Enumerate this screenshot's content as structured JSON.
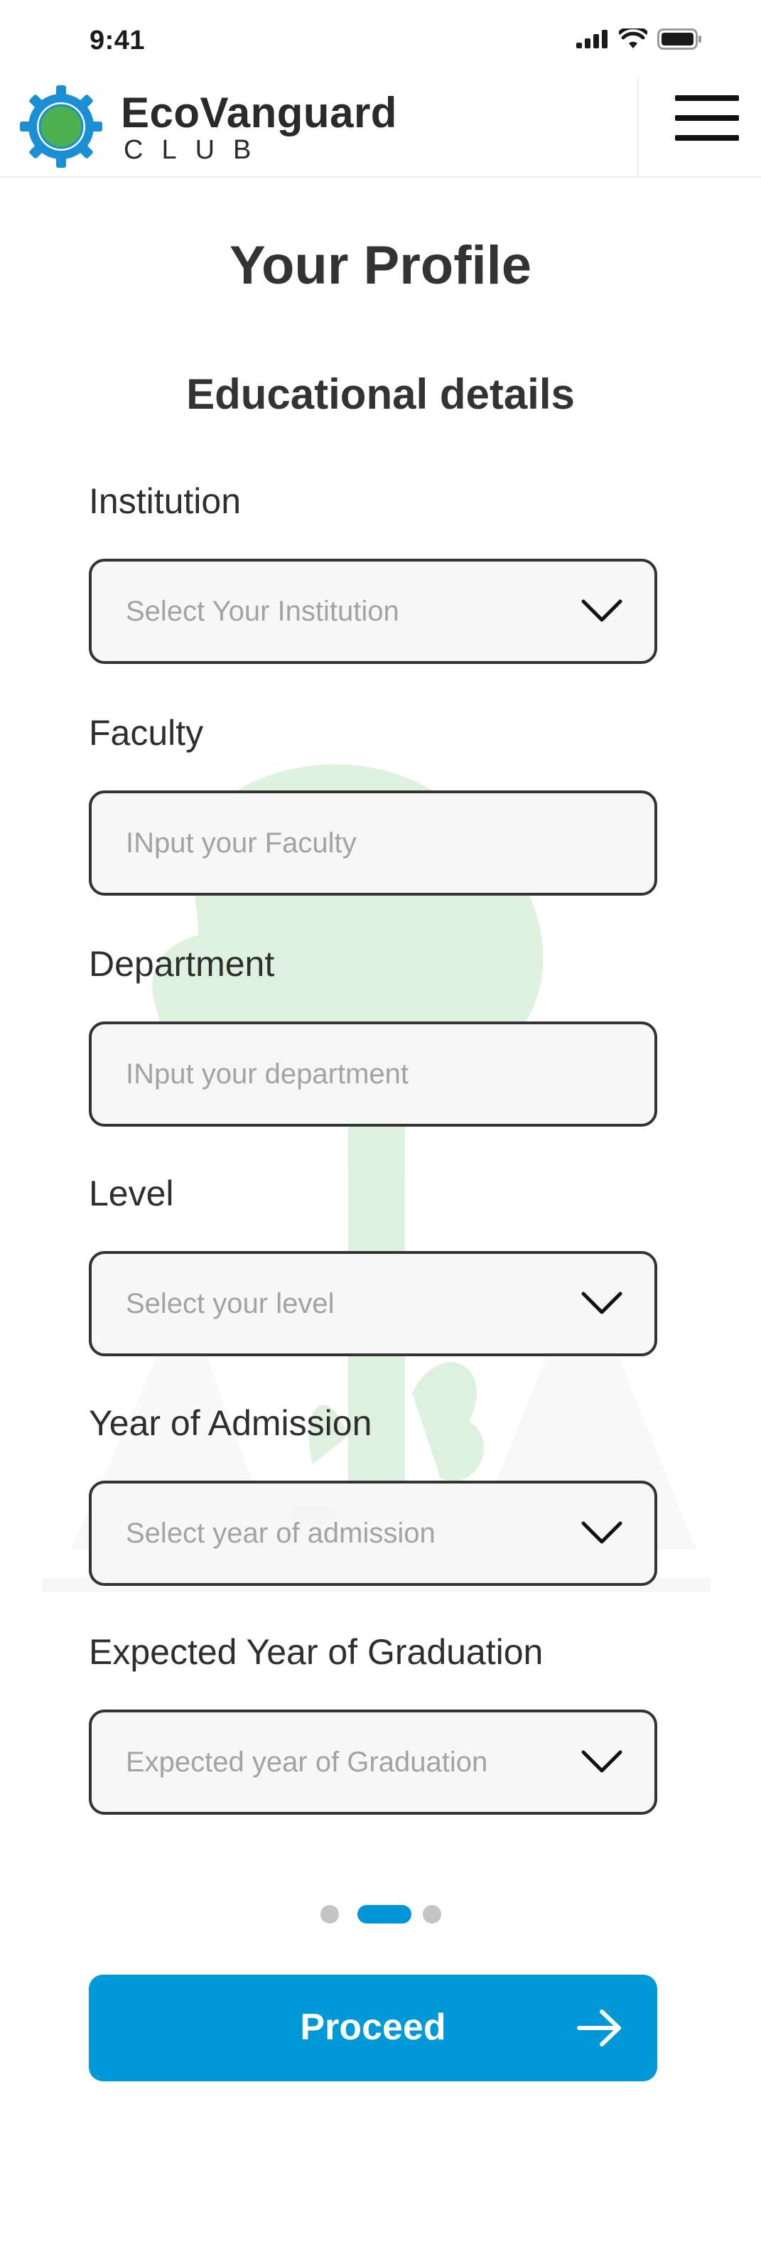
{
  "status_bar": {
    "time": "9:41",
    "icons": [
      "cellular-signal-icon",
      "wifi-icon",
      "battery-icon"
    ]
  },
  "header": {
    "brand_name": "EcoVanguard",
    "brand_sub": "CLUB",
    "logo_icon": "gear-globe-logo-icon",
    "menu_icon": "hamburger-menu-icon"
  },
  "page": {
    "title": "Your Profile",
    "section_title": "Educational details"
  },
  "form": {
    "institution": {
      "label": "Institution",
      "placeholder": "Select Your Institution",
      "type": "select"
    },
    "faculty": {
      "label": "Faculty",
      "placeholder": "INput your Faculty",
      "type": "text"
    },
    "department": {
      "label": "Department",
      "placeholder": "INput your department",
      "type": "text"
    },
    "level": {
      "label": "Level",
      "placeholder": "Select your level",
      "type": "select"
    },
    "year_of_admission": {
      "label": "Year of Admission",
      "placeholder": "Select year of admission",
      "type": "select"
    },
    "expected_graduation": {
      "label": "Expected Year of Graduation",
      "placeholder": "Expected year of Graduation",
      "type": "select"
    }
  },
  "pager": {
    "total": 3,
    "active_index": 1
  },
  "actions": {
    "proceed_label": "Proceed",
    "proceed_icon": "arrow-right-icon"
  },
  "colors": {
    "accent": "#0099D8",
    "text": "#2E2E2E",
    "placeholder": "#A3A3A3",
    "field_border": "#333333",
    "logo_blue": "#1A8FD6",
    "logo_green": "#4CAF50"
  }
}
